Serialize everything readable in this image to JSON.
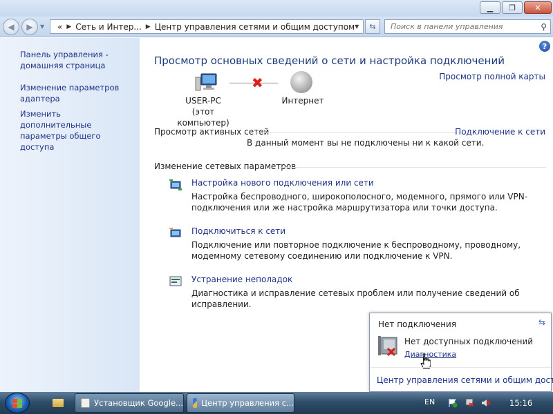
{
  "window": {
    "minimize_icon": "minimize-icon",
    "maximize_icon": "restore-icon",
    "close_icon": "close-icon"
  },
  "address": {
    "prefix": "«",
    "crumbs": [
      "Сеть и Интер...",
      "Центр управления сетями и общим доступом"
    ],
    "search_placeholder": "Поиск в панели управления"
  },
  "sidebar": {
    "items": [
      {
        "label": "Панель управления - домашняя страница"
      },
      {
        "label": "Изменение параметров адаптера"
      },
      {
        "label": "Изменить дополнительные параметры общего доступа"
      }
    ]
  },
  "main": {
    "heading": "Просмотр основных сведений о сети и настройка подключений",
    "full_map": "Просмотр полной карты",
    "computer": {
      "name": "USER-PC",
      "sub": "(этот компьютер)"
    },
    "internet": "Интернет",
    "active_networks": {
      "title": "Просмотр активных сетей",
      "link": "Подключение к сети",
      "status": "В данный момент вы не подключены ни к какой сети."
    },
    "change_settings_title": "Изменение сетевых параметров",
    "tasks": [
      {
        "title": "Настройка нового подключения или сети",
        "desc": "Настройка беспроводного, широкополосного, модемного, прямого или VPN-подключения или же настройка маршрутизатора или точки доступа."
      },
      {
        "title": "Подключиться к сети",
        "desc": "Подключение или повторное подключение к беспроводному, проводному, модемному сетевому соединению или подключение к VPN."
      },
      {
        "title": "Устранение неполадок",
        "desc": "Диагностика и исправление сетевых проблем или получение сведений об исправлении."
      }
    ]
  },
  "popup": {
    "title": "Нет подключения",
    "text": "Нет доступных подключений",
    "diagnostics": "Диагностика",
    "bottom_link": "Центр управления сетями и общим доступо"
  },
  "taskbar": {
    "tasks": [
      {
        "label": "Установщик Google..."
      },
      {
        "label": "Центр управления с..."
      }
    ],
    "language": "EN",
    "time": "15:16"
  },
  "colors": {
    "link": "#1e3287",
    "heading": "#1c3b7a",
    "error": "#dd1f1f"
  }
}
